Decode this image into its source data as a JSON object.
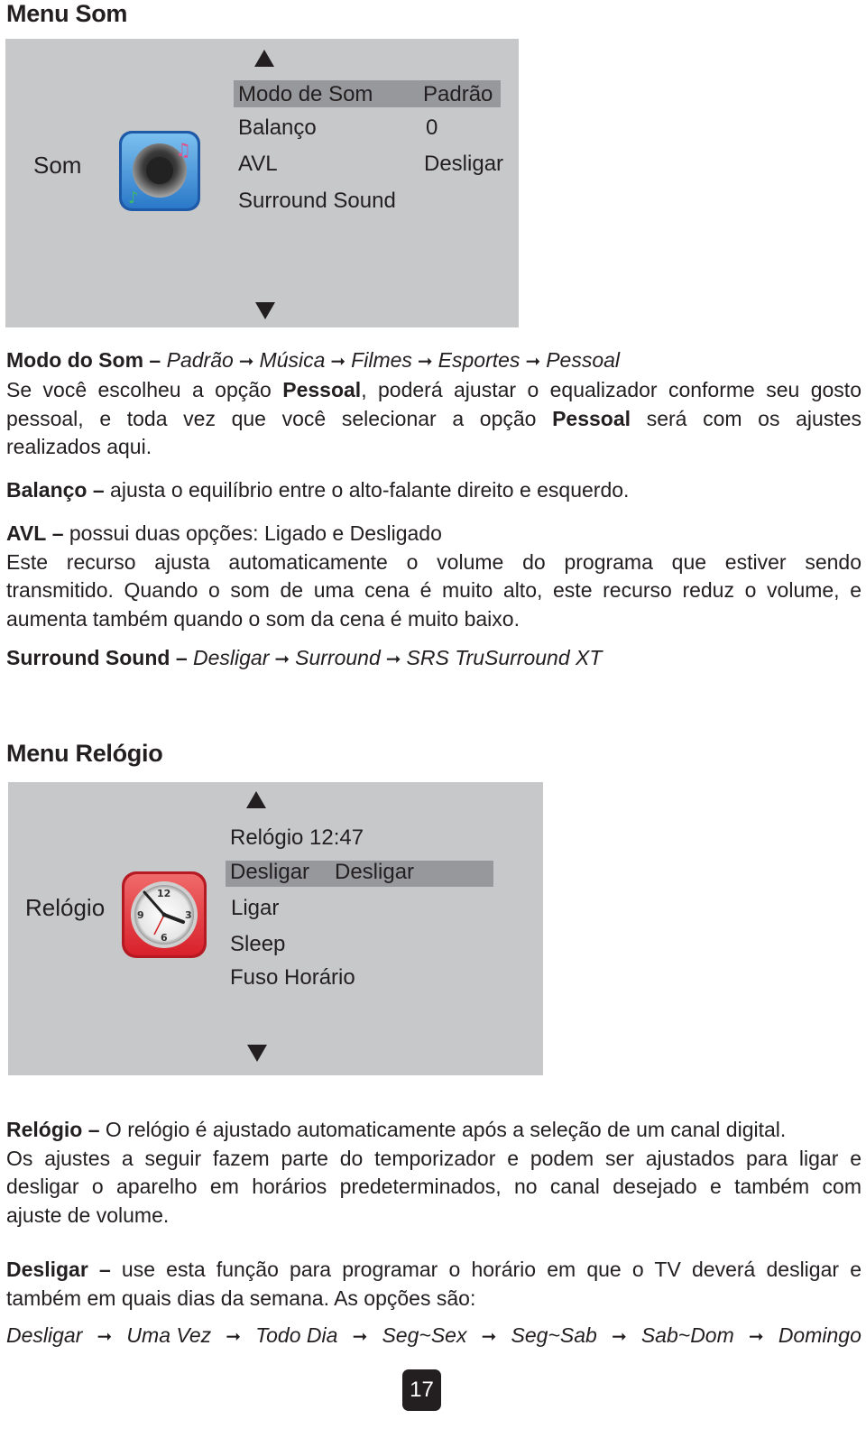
{
  "sound_menu": {
    "heading": "Menu Som",
    "panel": {
      "category_label": "Som",
      "icon": "speaker-music-icon",
      "scroll_up_icon": "triangle-up-icon",
      "scroll_down_icon": "triangle-down-icon",
      "items": [
        {
          "label": "Modo de Som",
          "value": "Padrão",
          "selected": true
        },
        {
          "label": "Balanço",
          "value": "0",
          "selected": false
        },
        {
          "label": "AVL",
          "value": "Desligar",
          "selected": false
        },
        {
          "label": "Surround Sound",
          "value": "",
          "selected": false
        }
      ]
    },
    "descriptions": {
      "modo": {
        "term": "Modo do Som",
        "dash": "–",
        "options": [
          "Padrão",
          "Música",
          "Filmes",
          "Esportes",
          "Pessoal"
        ],
        "text_1": "Se você escolheu a opção ",
        "bold_1": "Pessoal",
        "text_2": ", poderá ajustar o equalizador conforme seu gosto",
        "text_3": "pessoal, e toda vez que você selecionar a opção ",
        "bold_2": "Pessoal",
        "text_4": " será com os ajustes",
        "text_5": "realizados aqui."
      },
      "balanco": {
        "term": "Balanço",
        "dash": "–",
        "text": " ajusta o equilíbrio entre o alto-falante direito e esquerdo."
      },
      "avl": {
        "term": "AVL",
        "dash": "–",
        "text_1": " possui duas opções: Ligado e Desligado",
        "text_2": "Este recurso ajusta automaticamente o volume do programa que estiver sendo",
        "text_3": "transmitido. Quando o som de uma cena é muito alto, este recurso reduz o volume, e",
        "text_4": "aumenta também quando o som da cena é muito baixo."
      },
      "surround": {
        "term": "Surround Sound",
        "dash": "–",
        "options": [
          "Desligar",
          "Surround",
          "SRS TruSurround XT"
        ]
      }
    }
  },
  "clock_menu": {
    "heading": "Menu Relógio",
    "panel": {
      "category_label": "Relógio",
      "icon": "clock-icon",
      "scroll_up_icon": "triangle-up-icon",
      "scroll_down_icon": "triangle-down-icon",
      "items": [
        {
          "label": "Relógio 12:47",
          "value": "",
          "selected": false
        },
        {
          "label": "Desligar",
          "value": "Desligar",
          "selected": true
        },
        {
          "label": "Ligar",
          "value": "",
          "selected": false
        },
        {
          "label": "Sleep",
          "value": "",
          "selected": false
        },
        {
          "label": "Fuso Horário",
          "value": "",
          "selected": false
        }
      ]
    },
    "descriptions": {
      "relogio": {
        "term": "Relógio",
        "dash": "–",
        "text_1": " O relógio é ajustado automaticamente após a seleção de um canal digital.",
        "text_2": "Os ajustes a seguir fazem parte do temporizador e podem ser ajustados para ligar e",
        "text_3": "desligar o aparelho em horários predeterminados, no canal desejado e também com",
        "text_4": "ajuste de volume."
      },
      "desligar": {
        "term": "Desligar",
        "dash": "–",
        "text_1": " use esta função para programar o horário em que o TV deverá desligar e",
        "text_2": "também em quais dias da semana. As opções são:",
        "options": [
          "Desligar",
          "Uma Vez",
          "Todo Dia",
          "Seg~Sex",
          "Seg~Sab",
          "Sab~Dom",
          "Domingo"
        ]
      }
    }
  },
  "arrow_glyph": "➞",
  "page_number": "17"
}
